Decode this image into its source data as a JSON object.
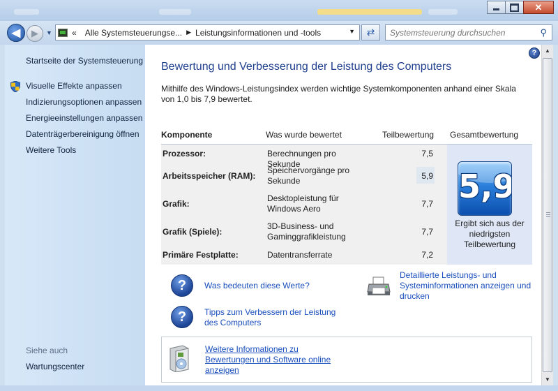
{
  "window": {
    "controls": {
      "minimize_icon": "minimize-icon",
      "maximize_icon": "maximize-icon",
      "close_icon": "close-icon"
    }
  },
  "nav": {
    "back_glyph": "◀",
    "forward_glyph": "▶",
    "breadcrumb_prefix": "«",
    "breadcrumbs": [
      "Alle Systemsteuerungse...",
      "Leistungsinformationen und -tools"
    ],
    "search_placeholder": "Systemsteuerung durchsuchen"
  },
  "sidebar": {
    "home": "Startseite der Systemsteuerung",
    "links": [
      "Visuelle Effekte anpassen",
      "Indizierungsoptionen anpassen",
      "Energieeinstellungen anpassen",
      "Datenträgerbereinigung öffnen",
      "Weitere Tools"
    ],
    "see_also_heading": "Siehe auch",
    "see_also": [
      "Wartungscenter"
    ]
  },
  "main": {
    "title": "Bewertung und Verbesserung der Leistung des Computers",
    "intro": "Mithilfe des Windows-Leistungsindex werden wichtige Systemkomponenten anhand einer Skala von 1,0 bis 7,9 bewertet.",
    "table": {
      "headers": [
        "Komponente",
        "Was wurde bewertet",
        "Teilbewertung",
        "Gesamtbewertung"
      ],
      "rows": [
        {
          "component": "Prozessor:",
          "rated": "Berechnungen pro Sekunde",
          "score": "7,5"
        },
        {
          "component": "Arbeitsspeicher (RAM):",
          "rated": "Speichervorgänge pro Sekunde",
          "score": "5,9"
        },
        {
          "component": "Grafik:",
          "rated": "Desktopleistung für Windows Aero",
          "score": "7,7"
        },
        {
          "component": "Grafik (Spiele):",
          "rated": "3D-Business- und Gaminggrafikleistung",
          "score": "7,7"
        },
        {
          "component": "Primäre Festplatte:",
          "rated": "Datentransferrate",
          "score": "7,2"
        }
      ],
      "overall_score": "5,9",
      "overall_caption": "Ergibt sich aus der niedrigsten Teilbewertung"
    },
    "links": {
      "what_values": "Was bedeuten diese Werte?",
      "tips": "Tipps zum Verbessern der Leistung des Computers",
      "details": "Detaillierte Leistungs- und Systeminformationen anzeigen und drucken",
      "more_info": "Weitere Informationen zu Bewertungen und Software online anzeigen"
    }
  },
  "colors": {
    "link": "#1a4fbd",
    "title": "#1e3e8e",
    "sidebar_bg": "#c7dcf2"
  }
}
